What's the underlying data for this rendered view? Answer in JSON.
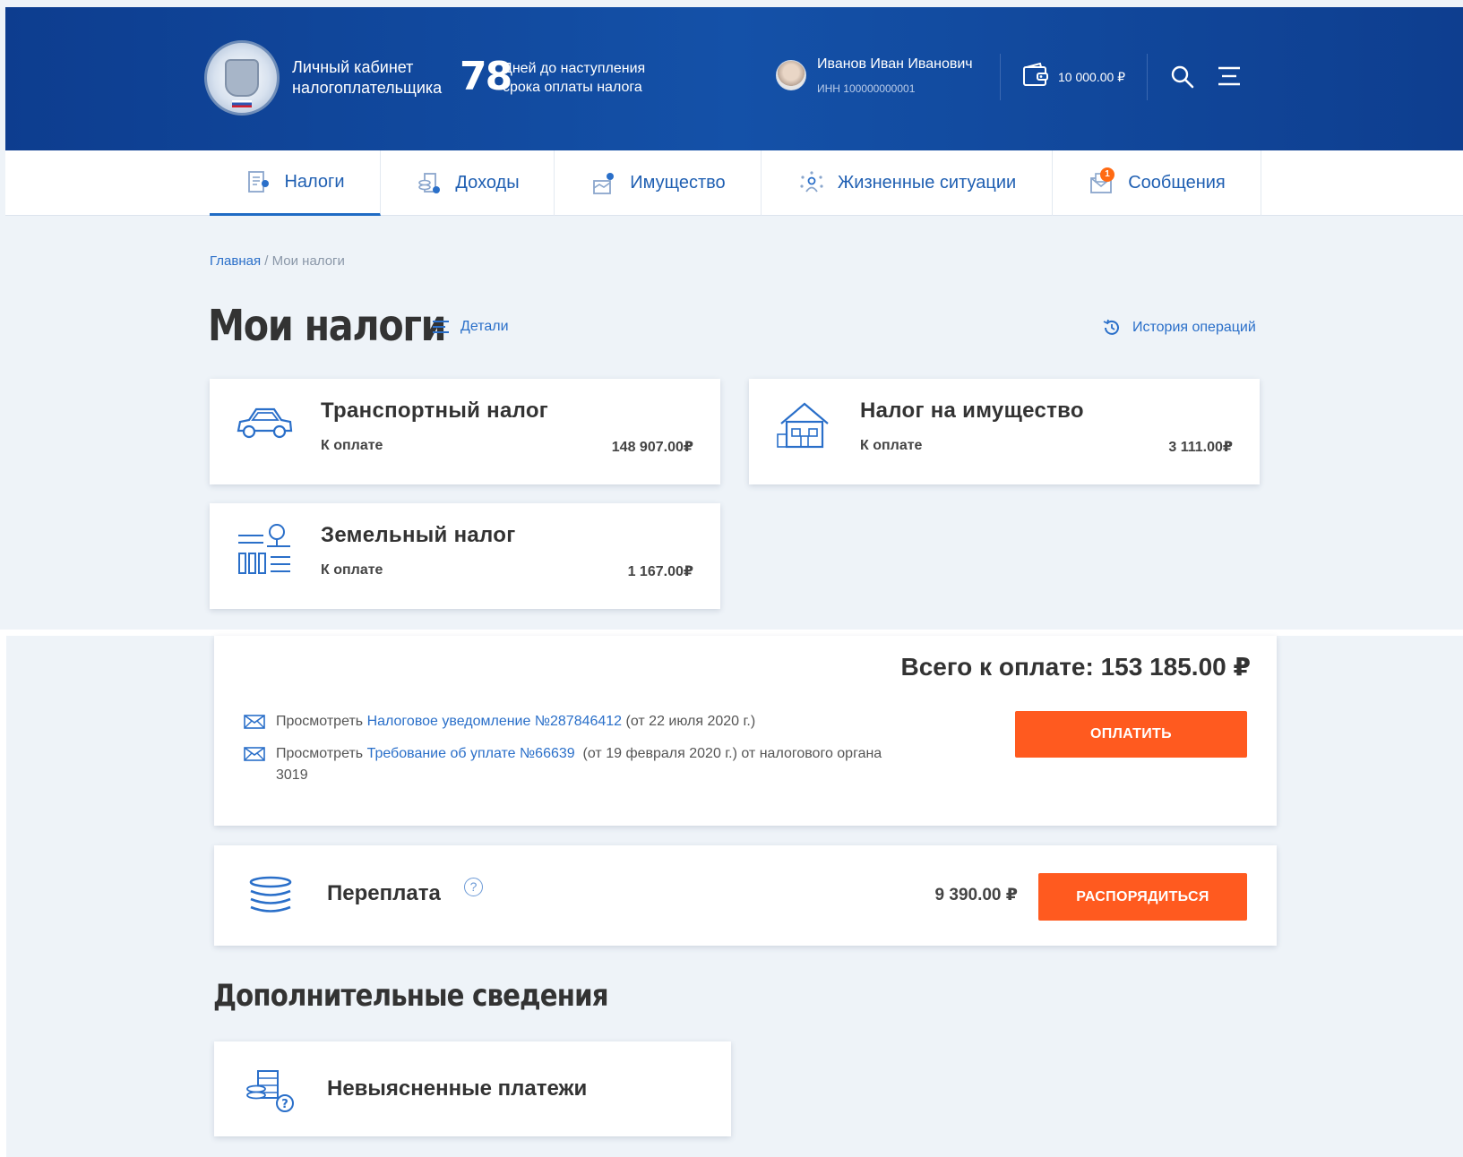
{
  "header": {
    "cabinet_line1": "Личный кабинет",
    "cabinet_line2": "налогоплательщика",
    "days_count": "78",
    "days_line1": "Дней до наступления",
    "days_line2": "срока оплаты налога",
    "user_name": "Иванов Иван Иванович",
    "user_inn": "ИНН 100000000001",
    "balance": "10 000.00 ₽"
  },
  "nav": {
    "items": [
      {
        "label": "Налоги",
        "icon": "tax-doc-icon",
        "active": true
      },
      {
        "label": "Доходы",
        "icon": "income-icon"
      },
      {
        "label": "Имущество",
        "icon": "property-icon"
      },
      {
        "label": "Жизненные ситуации",
        "icon": "life-situations-icon"
      },
      {
        "label": "Сообщения",
        "icon": "messages-icon",
        "badge": "1"
      }
    ]
  },
  "breadcrumb": {
    "home": "Главная",
    "separator": " / ",
    "current": "Мои налоги"
  },
  "page": {
    "title": "Мои налоги",
    "details_label": "Детали",
    "history_label": "История операций"
  },
  "taxes": [
    {
      "title": "Транспортный налог",
      "label": "К оплате",
      "amount": "148 907.00₽",
      "icon": "car-icon"
    },
    {
      "title": "Налог на имущество",
      "label": "К оплате",
      "amount": "3 111.00₽",
      "icon": "house-icon"
    },
    {
      "title": "Земельный налог",
      "label": "К оплате",
      "amount": "1 167.00₽",
      "icon": "land-icon"
    }
  ],
  "summary": {
    "total": "Всего к оплате: 153 185.00 ₽",
    "doc1_prefix": "Просмотреть",
    "doc1_link": "Налоговое уведомление №287846412",
    "doc1_suffix": "(от 22 июля 2020 г.)",
    "doc2_prefix": "Просмотреть",
    "doc2_link": "Требование об уплате №66639",
    "doc2_suffix": "(от 19 февраля 2020 г.) от налогового органа",
    "doc2_suffix2": "3019",
    "pay_button": "ОПЛАТИТЬ"
  },
  "overpayment": {
    "label": "Переплата",
    "help": "?",
    "amount": "9 390.00 ₽",
    "button": "РАСПОРЯДИТЬСЯ"
  },
  "additional": {
    "title": "Дополнительные сведения",
    "unclear_payments": "Невыясненные платежи"
  },
  "colors": {
    "header_blue": "#1451a8",
    "accent_blue": "#2a6fc9",
    "orange": "#ff5a1f"
  }
}
